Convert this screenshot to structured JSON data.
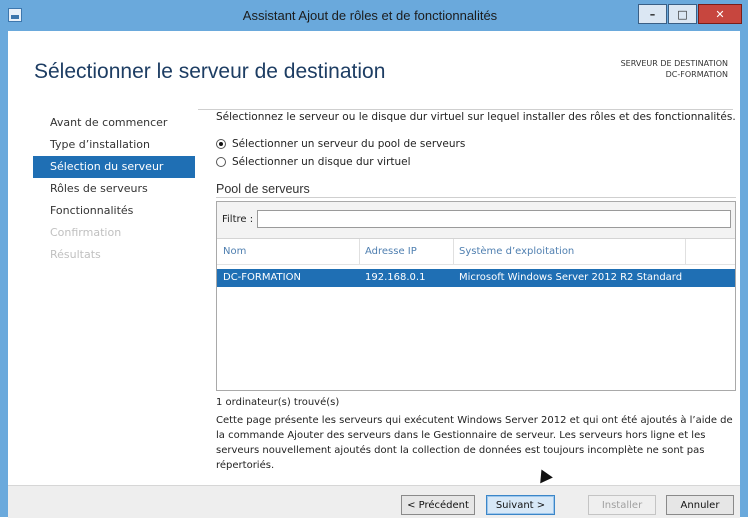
{
  "window": {
    "title": "Assistant Ajout de rôles et de fonctionnalités",
    "controls": {
      "minimize": "–",
      "maximize": "□",
      "close": "✕"
    }
  },
  "header": {
    "title": "Sélectionner le serveur de destination",
    "destination_label": "SERVEUR DE DESTINATION",
    "destination_value": "DC-FORMATION"
  },
  "nav": {
    "items": [
      {
        "label": "Avant de commencer",
        "state": "normal"
      },
      {
        "label": "Type d’installation",
        "state": "normal"
      },
      {
        "label": "Sélection du serveur",
        "state": "active"
      },
      {
        "label": "Rôles de serveurs",
        "state": "normal"
      },
      {
        "label": "Fonctionnalités",
        "state": "normal"
      },
      {
        "label": "Confirmation",
        "state": "disabled"
      },
      {
        "label": "Résultats",
        "state": "disabled"
      }
    ]
  },
  "main": {
    "intro": "Sélectionnez le serveur ou le disque dur virtuel sur lequel installer des rôles et des fonctionnalités.",
    "options": [
      {
        "label": "Sélectionner un serveur du pool de serveurs",
        "checked": true
      },
      {
        "label": "Sélectionner un disque dur virtuel",
        "checked": false
      }
    ],
    "pool_title": "Pool de serveurs",
    "filter_label": "Filtre :",
    "filter_value": "",
    "columns": [
      "Nom",
      "Adresse IP",
      "Système d’exploitation"
    ],
    "rows": [
      {
        "name": "DC-FORMATION",
        "ip": "192.168.0.1",
        "os": "Microsoft Windows Server 2012 R2 Standard",
        "selected": true
      }
    ],
    "found": "1 ordinateur(s) trouvé(s)",
    "description": "Cette page présente les serveurs qui exécutent Windows Server 2012 et qui ont été ajoutés à l’aide de la commande Ajouter des serveurs dans le Gestionnaire de serveur. Les serveurs hors ligne et les serveurs nouvellement ajoutés dont la collection de données est toujours incomplète ne sont pas répertoriés."
  },
  "footer": {
    "previous": "< Précédent",
    "next": "Suivant >",
    "install": "Installer",
    "cancel": "Annuler"
  },
  "colors": {
    "title_bar": "#6aa9dc",
    "selection": "#1f6fb4",
    "heading": "#1d3d63",
    "close_button": "#c7463e"
  }
}
